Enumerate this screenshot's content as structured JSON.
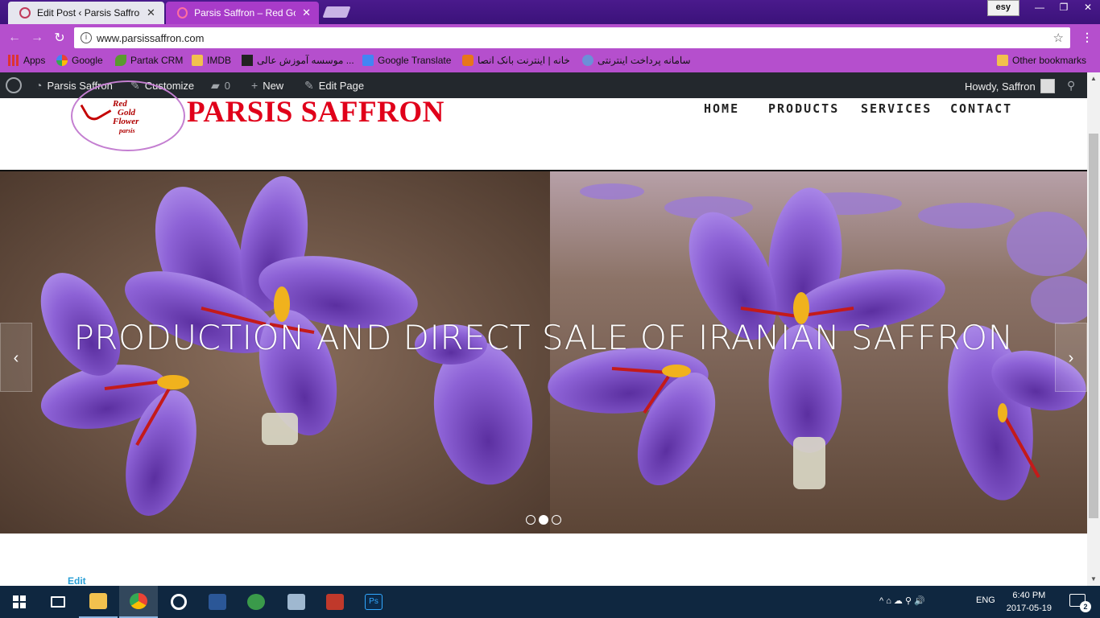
{
  "browser": {
    "tabs": [
      {
        "title": "Edit Post ‹ Parsis Saffron",
        "close": "✕"
      },
      {
        "title": "Parsis Saffron – Red Gold",
        "close": "✕"
      }
    ],
    "profile": "esy",
    "window_controls": {
      "minimize": "—",
      "restore": "❐",
      "close": "✕"
    },
    "url": "www.parsissaffron.com",
    "info_icon": "i",
    "star_icon": "☆",
    "menu_icon": "⋮"
  },
  "bookmarks": {
    "items": [
      "Apps",
      "Google",
      "Partak CRM",
      "IMDB",
      "موسسه آموزش عالی ...",
      "Google Translate",
      "خانه | اینترنت بانک انصا",
      "سامانه پرداخت اینترنتی"
    ],
    "other": "Other bookmarks"
  },
  "wpbar": {
    "site": "Parsis Saffron",
    "customize": "Customize",
    "comments": "0",
    "new": "New",
    "edit_page": "Edit Page",
    "howdy": "Howdy, Saffron"
  },
  "site": {
    "logo_lines": [
      "Red",
      "Gold",
      "Flower",
      "parsis"
    ],
    "brand": "PARSIS SAFFRON",
    "nav": [
      "HOME",
      "PRODUCTS",
      "SERVICES",
      "CONTACT"
    ]
  },
  "slider": {
    "caption": "PRODUCTION AND DIRECT SALE OF IRANIAN SAFFRON",
    "prev": "‹",
    "next": "›",
    "slide_count": 3,
    "active_slide": 2
  },
  "page": {
    "edit_link": "Edit"
  },
  "taskbar": {
    "language": "ENG",
    "time": "6:40 PM",
    "date": "2017-05-19",
    "notification_count": "2",
    "tray_icons": "^  ⌂  ☁  ⚲  🔊"
  }
}
